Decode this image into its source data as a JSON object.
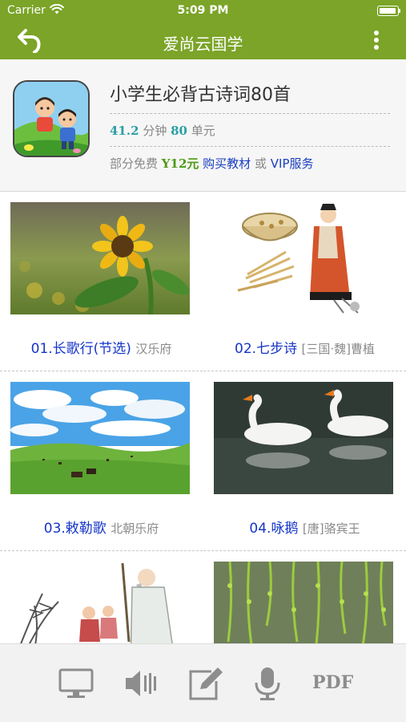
{
  "status_bar": {
    "carrier": "Carrier",
    "time": "5:09 PM"
  },
  "nav": {
    "title": "爱尚云国学",
    "back_icon": "back-arrow-icon",
    "more_icon": "more-vertical-icon"
  },
  "colors": {
    "header": "#7ba428",
    "title_link": "#1535c8",
    "stat_number": "#2a9fa3",
    "price": "#4d9a12"
  },
  "book": {
    "title": "小学生必背古诗词80首",
    "duration": "41.2",
    "duration_unit": "分钟",
    "units": "80",
    "units_unit": "单元",
    "free_label": "部分免费",
    "price": "Y12元",
    "buy_link": "购买教材",
    "or": "或",
    "vip_link": "VIP服务"
  },
  "lessons": [
    {
      "title": "01.长歌行(节选)",
      "author": "汉乐府"
    },
    {
      "title": "02.七步诗",
      "author": "[三国·魏]曹植"
    },
    {
      "title": "03.敕勒歌",
      "author": "北朝乐府"
    },
    {
      "title": "04.咏鹅",
      "author": "[唐]骆宾王"
    },
    {
      "title": "",
      "author": ""
    },
    {
      "title": "",
      "author": ""
    }
  ],
  "toolbar": [
    "monitor-icon",
    "speaker-icon",
    "edit-icon",
    "microphone-icon",
    "pdf-icon"
  ],
  "toolbar_pdf_text": "PDF"
}
